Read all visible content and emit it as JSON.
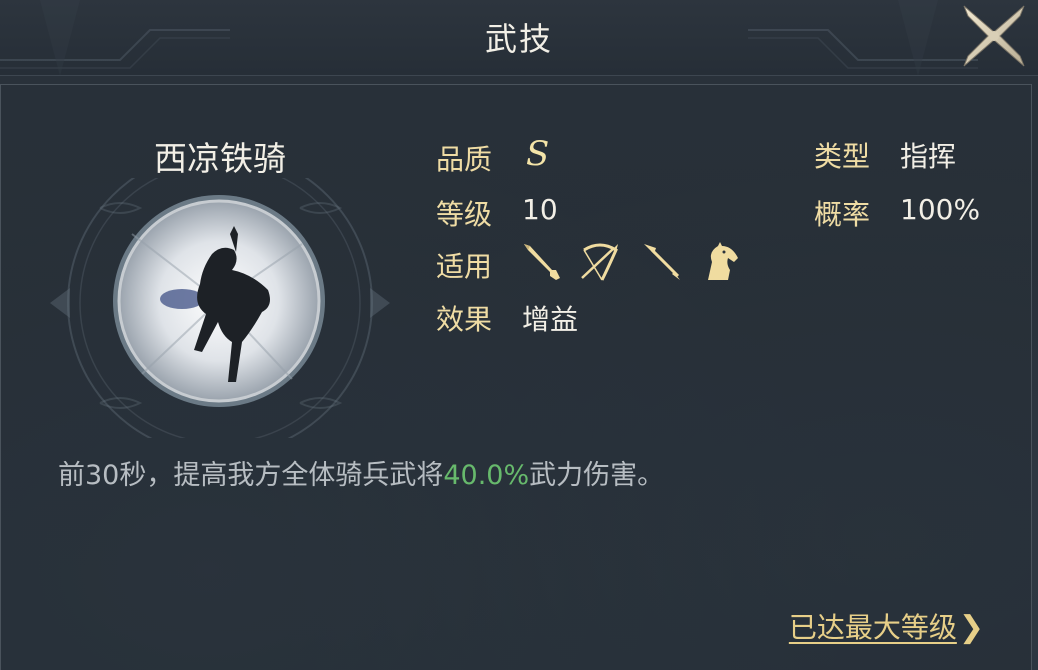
{
  "window": {
    "title": "武技"
  },
  "skill": {
    "name": "西凉铁骑",
    "quality_label": "品质",
    "quality_value": "S",
    "level_label": "等级",
    "level_value": "10",
    "apply_label": "适用",
    "apply_icons": [
      "sword-icon",
      "bow-icon",
      "spear-icon",
      "horse-icon"
    ],
    "effect_label": "效果",
    "effect_value": "增益",
    "type_label": "类型",
    "type_value": "指挥",
    "chance_label": "概率",
    "chance_value": "100%"
  },
  "description": {
    "before": "前30秒，提高我方全体骑兵武将",
    "highlight": "40.0%",
    "after": "武力伤害。"
  },
  "footer": {
    "max_level_text": "已达最大等级",
    "arrow": "❯"
  },
  "colors": {
    "label_gold": "#efdca4",
    "text_white": "#f2efe6",
    "desc_grey": "#b7bdc2",
    "highlight_green": "#67b96c",
    "link_gold": "#e7cf88",
    "background": "#262e37"
  }
}
